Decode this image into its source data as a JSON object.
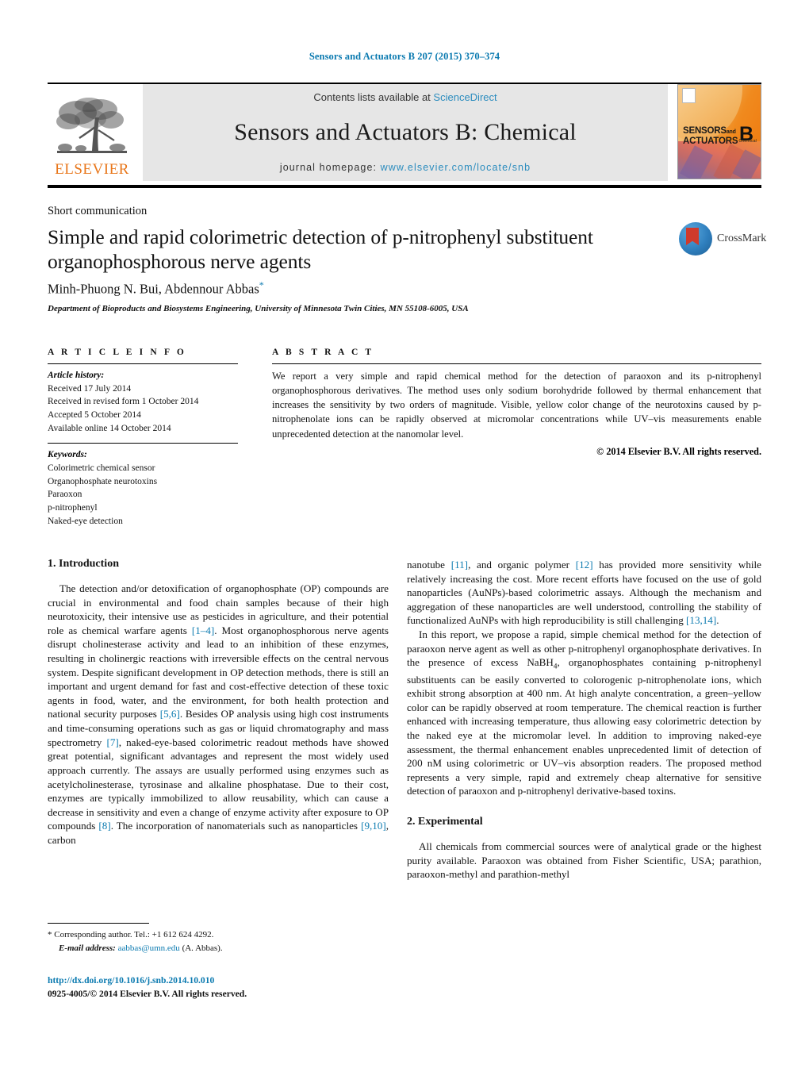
{
  "running_head": "Sensors and Actuators B 207 (2015) 370–374",
  "masthead": {
    "contents_prefix": "Contents lists available at",
    "sciencedirect": "ScienceDirect",
    "journal_title": "Sensors and Actuators B: Chemical",
    "homepage_label": "journal homepage:",
    "homepage_url": "www.elsevier.com/locate/snb",
    "publisher": "ELSEVIER",
    "cover": {
      "line1": "SENSORS",
      "and": "and",
      "line2": "ACTUATORS",
      "letter": "B",
      "sub": "Chemical"
    }
  },
  "article": {
    "doctype": "Short communication",
    "crossmark_label": "CrossMark",
    "title": "Simple and rapid colorimetric detection of p-nitrophenyl substituent organophosphorous nerve agents",
    "authors": "Minh-Phuong N. Bui, Abdennour Abbas",
    "author_marker": "*",
    "affiliation": "Department of Bioproducts and Biosystems Engineering, University of Minnesota Twin Cities, MN 55108-6005, USA"
  },
  "info": {
    "heading": "A R T I C L E    I N F O",
    "history_label": "Article history:",
    "history": [
      "Received 17 July 2014",
      "Received in revised form 1 October 2014",
      "Accepted 5 October 2014",
      "Available online 14 October 2014"
    ],
    "keywords_label": "Keywords:",
    "keywords": [
      "Colorimetric chemical sensor",
      "Organophosphate neurotoxins",
      "Paraoxon",
      "p-nitrophenyl",
      "Naked-eye detection"
    ]
  },
  "abstract": {
    "heading": "A B S T R A C T",
    "text": "We report a very simple and rapid chemical method for the detection of paraoxon and its p-nitrophenyl organophosphorous derivatives. The method uses only sodium borohydride followed by thermal enhancement that increases the sensitivity by two orders of magnitude. Visible, yellow color change of the neurotoxins caused by p-nitrophenolate ions can be rapidly observed at micromolar concentrations while UV–vis measurements enable unprecedented detection at the nanomolar level.",
    "copyright": "© 2014 Elsevier B.V. All rights reserved."
  },
  "body": {
    "intro_heading": "1.  Introduction",
    "experimental_heading": "2.  Experimental",
    "left_p1_a": "The detection and/or detoxification of organophosphate (OP) compounds are crucial in environmental and food chain samples because of their high neurotoxicity, their intensive use as pesticides in agriculture, and their potential role as chemical warfare agents ",
    "left_ref1": "[1–4]",
    "left_p1_b": ". Most organophosphorous nerve agents disrupt cholinesterase activity and lead to an inhibition of these enzymes, resulting in cholinergic reactions with irreversible effects on the central nervous system. Despite significant development in OP detection methods, there is still an important and urgent demand for fast and cost-effective detection of these toxic agents in food, water, and the environment, for both health protection and national security purposes ",
    "left_ref2": "[5,6]",
    "left_p1_c": ". Besides OP analysis using high cost instruments and time-consuming operations such as gas or liquid chromatography and mass spectrometry ",
    "left_ref3": "[7]",
    "left_p1_d": ", naked-eye-based colorimetric readout methods have showed great potential, significant advantages and represent the most widely used approach currently. The assays are usually performed using enzymes such as acetylcholinesterase, tyrosinase and alkaline phosphatase. Due to their cost, enzymes are typically immobilized to allow reusability, which can cause a decrease in sensitivity and even a change of enzyme activity after exposure to OP compounds ",
    "left_ref4": "[8]",
    "left_p1_e": ". The incorporation of nanomaterials such as nanoparticles ",
    "left_ref5": "[9,10]",
    "left_p1_f": ", carbon",
    "right_p1_a": "nanotube ",
    "right_ref1": "[11]",
    "right_p1_b": ", and organic polymer ",
    "right_ref2": "[12]",
    "right_p1_c": " has provided more sensitivity while relatively increasing the cost. More recent efforts have focused on the use of gold nanoparticles (AuNPs)-based colorimetric assays. Although the mechanism and aggregation of these nanoparticles are well understood, controlling the stability of functionalized AuNPs with high reproducibility is still challenging ",
    "right_ref3": "[13,14]",
    "right_p1_d": ".",
    "right_p2_a": "In this report, we propose a rapid, simple chemical method for the detection of paraoxon nerve agent as well as other p-nitrophenyl organophosphate derivatives. In the presence of excess NaBH",
    "right_p2_sub": "4",
    "right_p2_b": ", organophosphates containing p-nitrophenyl substituents can be easily converted to colorogenic p-nitrophenolate ions, which exhibit strong absorption at 400 nm. At high analyte concentration, a green–yellow color can be rapidly observed at room temperature. The chemical reaction is further enhanced with increasing temperature, thus allowing easy colorimetric detection by the naked eye at the micromolar level. In addition to improving naked-eye assessment, the thermal enhancement enables unprecedented limit of detection of 200 nM using colorimetric or UV–vis absorption readers. The proposed method represents a very simple, rapid and extremely cheap alternative for sensitive detection of paraoxon and p-nitrophenyl derivative-based toxins.",
    "right_p3": "All chemicals from commercial sources were of analytical grade or the highest purity available. Paraoxon was obtained from Fisher Scientific, USA; parathion, paraoxon-methyl and parathion-methyl"
  },
  "footnote": {
    "marker": "*",
    "corresponding": "Corresponding author. Tel.: +1 612 624 4292.",
    "email_label": "E-mail address:",
    "email": "aabbas@umn.edu",
    "email_suffix": "(A. Abbas).",
    "doi": "http://dx.doi.org/10.1016/j.snb.2014.10.010",
    "issn": "0925-4005/© 2014 Elsevier B.V. All rights reserved."
  },
  "colors": {
    "link": "#0b7ab0",
    "elsevier_orange": "#e8761a",
    "sciencedirect": "#2b8cbe",
    "band_gray": "#e6e6e6"
  }
}
